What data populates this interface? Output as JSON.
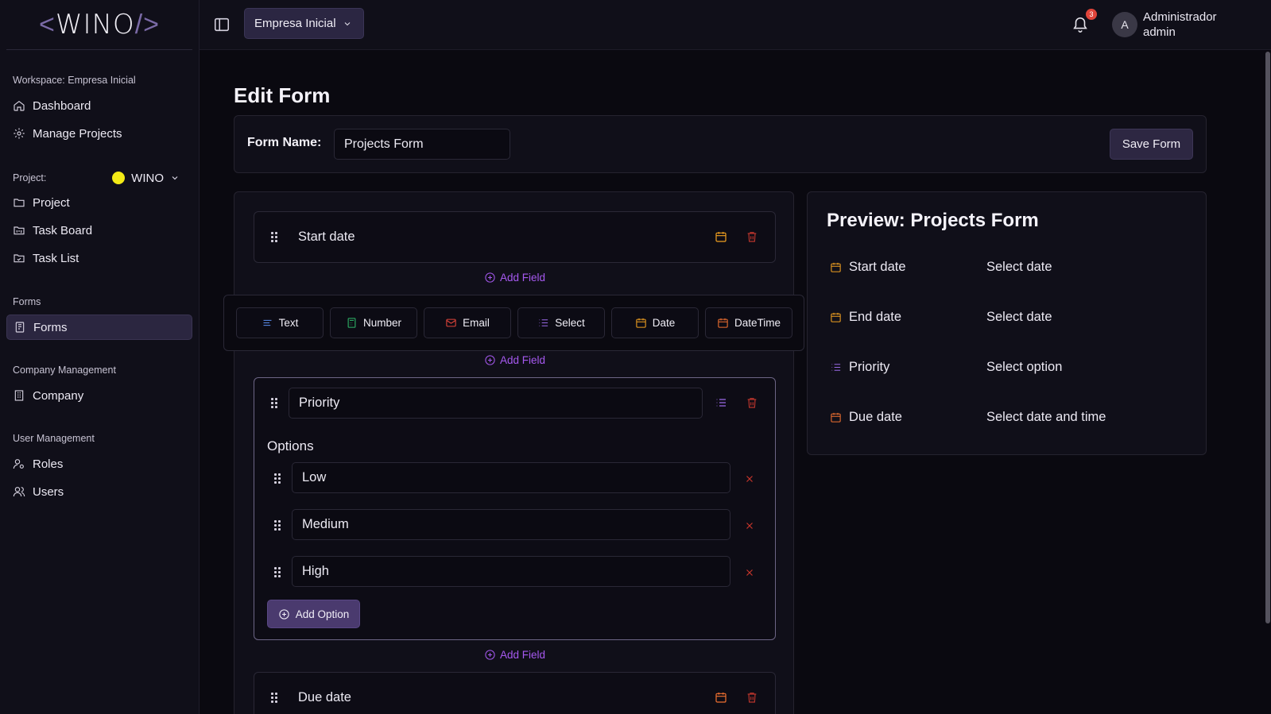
{
  "app": {
    "logo_left": "<",
    "logo_word": "WINO",
    "logo_right": "/>"
  },
  "sidebar": {
    "workspace_label": "Workspace: Empresa Inicial",
    "items_top": [
      {
        "label": "Dashboard",
        "icon": "home-icon"
      },
      {
        "label": "Manage Projects",
        "icon": "gear-icon"
      }
    ],
    "project_label": "Project:",
    "project_name": "WINO",
    "project_color": "#f3ea16",
    "items_project": [
      {
        "label": "Project",
        "icon": "folder-icon"
      },
      {
        "label": "Task Board",
        "icon": "board-icon"
      },
      {
        "label": "Task List",
        "icon": "list-folder-icon"
      }
    ],
    "forms_label": "Forms",
    "forms_item": {
      "label": "Forms",
      "icon": "form-icon",
      "active": true
    },
    "company_label": "Company Management",
    "company_item": {
      "label": "Company",
      "icon": "building-icon"
    },
    "users_label": "User Management",
    "roles_item": {
      "label": "Roles",
      "icon": "roles-icon"
    },
    "users_item": {
      "label": "Users",
      "icon": "users-icon"
    }
  },
  "topbar": {
    "company": "Empresa Inicial",
    "notification_count": "3",
    "avatar_initial": "A",
    "user_name": "Administrador",
    "user_role": "admin"
  },
  "page": {
    "title": "Edit Form",
    "form_name_label": "Form Name:",
    "form_name_value": "Projects Form",
    "save_label": "Save Form",
    "add_field_label": "Add Field",
    "field_types": [
      {
        "label": "Text",
        "icon": "text-icon",
        "color": "#5b8ef0"
      },
      {
        "label": "Number",
        "icon": "calculator-icon",
        "color": "#2fb86a"
      },
      {
        "label": "Email",
        "icon": "mail-icon",
        "color": "#e0443a"
      },
      {
        "label": "Select",
        "icon": "list-icon",
        "color": "#9a6ae8"
      },
      {
        "label": "Date",
        "icon": "calendar-icon",
        "color": "#f0a020"
      },
      {
        "label": "DateTime",
        "icon": "calendar-icon",
        "color": "#f07030"
      }
    ],
    "fields": [
      {
        "name": "Start date",
        "type": "date"
      },
      {
        "name": "Priority",
        "type": "select",
        "options_label": "Options",
        "options": [
          "Low",
          "Medium",
          "High"
        ],
        "add_option_label": "Add Option"
      },
      {
        "name": "Due date",
        "type": "datetime"
      }
    ]
  },
  "preview": {
    "title": "Preview: Projects Form",
    "rows": [
      {
        "label": "Start date",
        "value": "Select date",
        "icon": "calendar-icon",
        "color": "#f0a020"
      },
      {
        "label": "End date",
        "value": "Select date",
        "icon": "calendar-icon",
        "color": "#f0a020"
      },
      {
        "label": "Priority",
        "value": "Select option",
        "icon": "list-icon",
        "color": "#9a6ae8"
      },
      {
        "label": "Due date",
        "value": "Select date and time",
        "icon": "calendar-icon",
        "color": "#f07030"
      }
    ]
  },
  "colors": {
    "accent": "#a659f0",
    "danger": "#e0443a",
    "calendar": "#f0a020"
  }
}
